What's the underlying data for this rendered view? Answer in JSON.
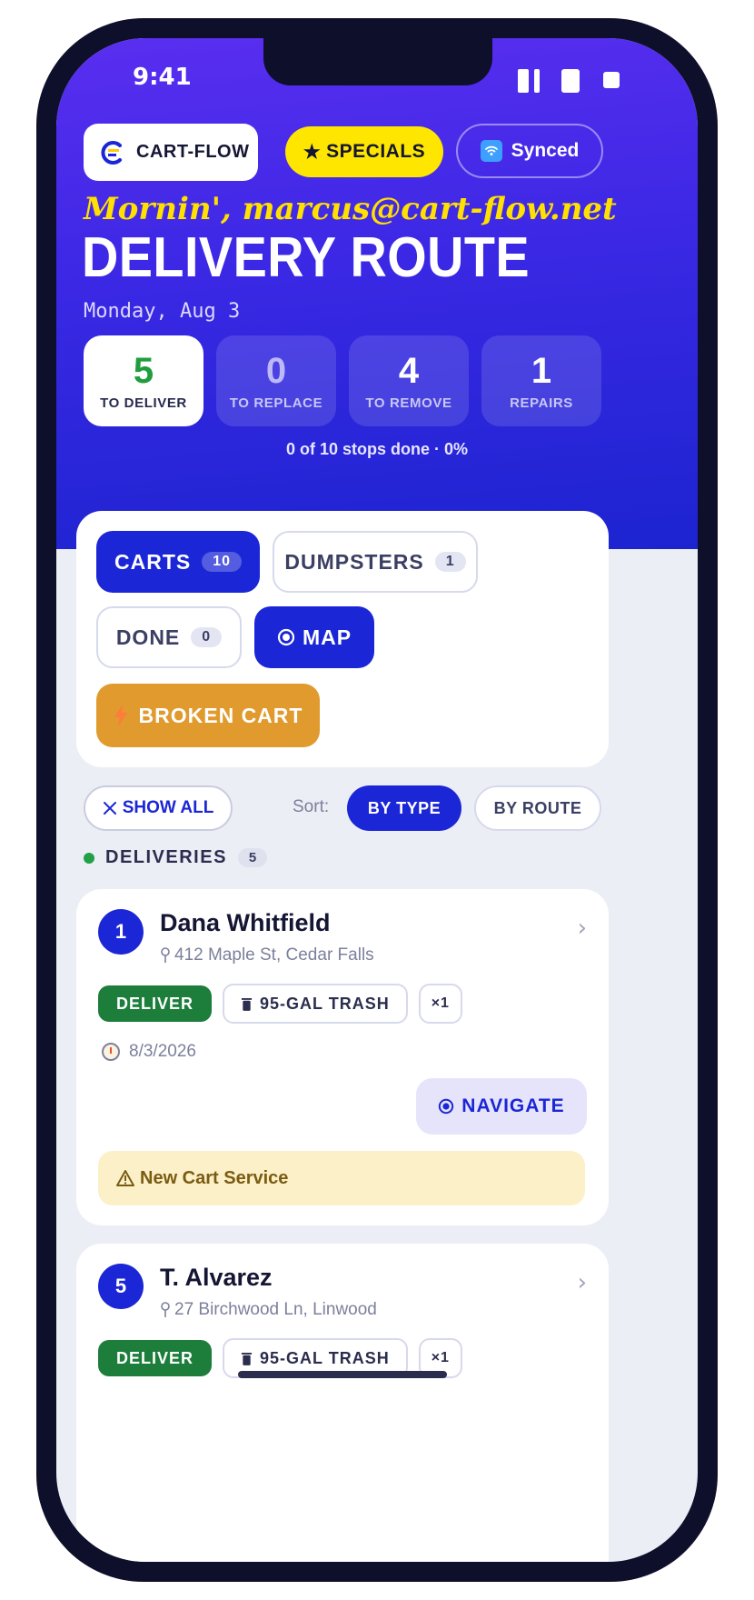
{
  "status_bar": {
    "time": "9:41"
  },
  "header": {
    "brand": "CART-FLOW",
    "specials_label": "SPECIALS",
    "sync_label": "Synced",
    "greeting": "Mornin', marcus@cart-flow.net",
    "title": "DELIVERY ROUTE",
    "date": "Monday, Aug 3",
    "stats": [
      {
        "value": "5",
        "label": "TO DELIVER"
      },
      {
        "value": "0",
        "label": "TO REPLACE"
      },
      {
        "value": "4",
        "label": "TO REMOVE"
      },
      {
        "value": "1",
        "label": "REPAIRS"
      }
    ],
    "progress_text": "0 of 10 stops done · 0%"
  },
  "filters": {
    "carts": {
      "label": "CARTS",
      "count": "10"
    },
    "dumpsters": {
      "label": "DUMPSTERS",
      "count": "1"
    },
    "done": {
      "label": "DONE",
      "count": "0"
    },
    "map": {
      "label": "MAP"
    },
    "broken_cart": {
      "label": "BROKEN CART"
    }
  },
  "controls": {
    "show_all": "SHOW ALL",
    "sort_label": "Sort:",
    "sort_by_type": "BY TYPE",
    "sort_by_route": "BY ROUTE"
  },
  "section": {
    "title": "DELIVERIES",
    "count": "5"
  },
  "stops": [
    {
      "number": "1",
      "name": "Dana Whitfield",
      "address": "412 Maple St, Cedar Falls",
      "action": "DELIVER",
      "cart": "95-GAL TRASH",
      "qty": "×1",
      "date": "8/3/2026",
      "navigate": "NAVIGATE",
      "notice": "New Cart Service"
    },
    {
      "number": "5",
      "name": "T. Alvarez",
      "address": "27 Birchwood Ln, Linwood",
      "action": "DELIVER",
      "cart": "95-GAL TRASH",
      "qty": "×1"
    }
  ],
  "colors": {
    "accent": "#1b26d6",
    "header_top": "#5a2ef0",
    "deliver_green": "#1c7e3a",
    "specials_yellow": "#ffe600",
    "broken_orange": "#e09a2e",
    "notice_bg": "#fcf0c9"
  },
  "icons": [
    "cart-flow-logo",
    "star-icon",
    "wifi-icon",
    "map-target-icon",
    "bolt-icon",
    "close-icon",
    "pin-icon",
    "trash-can-icon",
    "clock-icon",
    "navigate-icon",
    "warning-icon",
    "chevron-right-icon"
  ]
}
